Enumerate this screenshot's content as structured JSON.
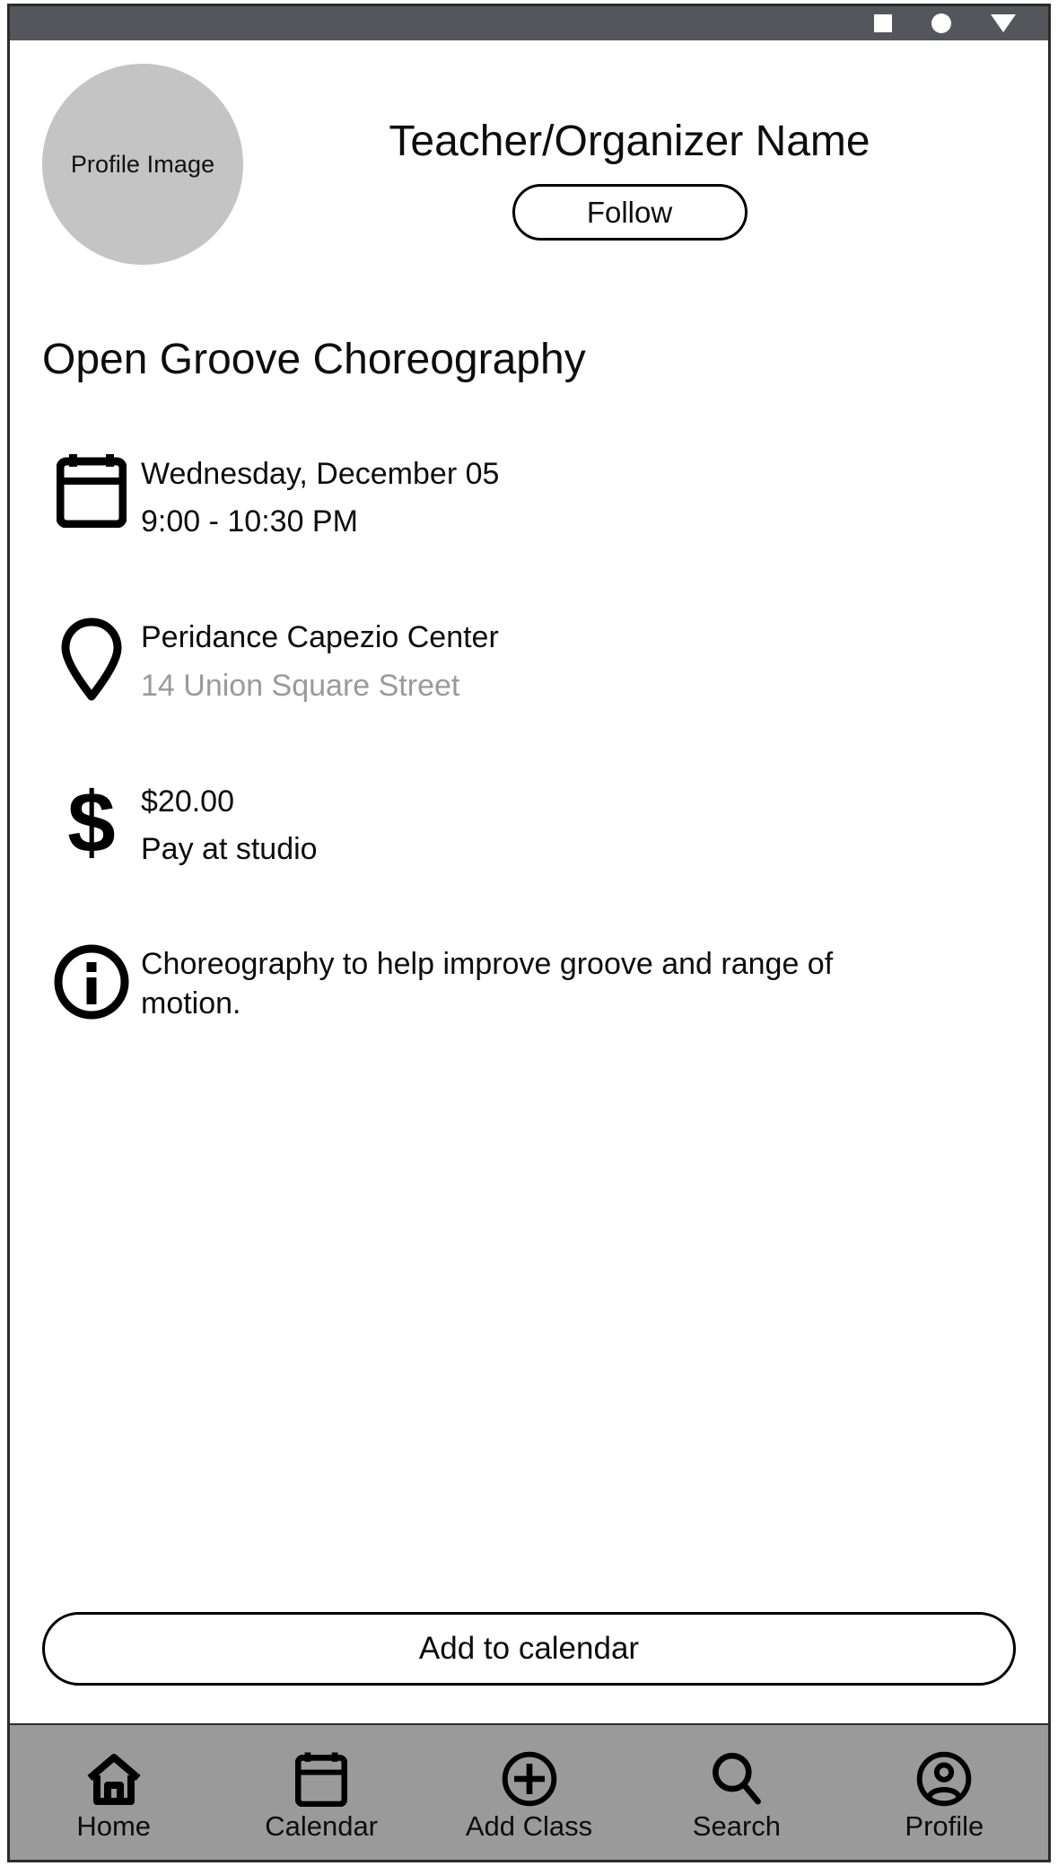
{
  "status_bar": {
    "background": "#55565b",
    "icons": [
      "square-icon",
      "circle-icon",
      "triangle-down-icon"
    ]
  },
  "profile": {
    "avatar_label": "Profile Image",
    "organizer_name": "Teacher/Organizer Name",
    "follow_label": "Follow"
  },
  "event": {
    "title": "Open Groove Choreography",
    "rows": [
      {
        "icon": "calendar-icon",
        "primary": "Wednesday, December 05",
        "secondary": "9:00 - 10:30 PM",
        "secondary_muted": false
      },
      {
        "icon": "location-pin-icon",
        "primary": "Peridance Capezio Center",
        "secondary": "14 Union Square Street",
        "secondary_muted": true
      },
      {
        "icon": "dollar-sign-icon",
        "primary": "$20.00",
        "secondary": "Pay at studio",
        "secondary_muted": false
      },
      {
        "icon": "info-circle-icon",
        "paragraph": "Choreography to help improve groove and range of motion."
      }
    ],
    "add_to_calendar_label": "Add to calendar"
  },
  "bottom_nav": {
    "background": "#9a9a9a",
    "items": [
      {
        "icon": "home-icon",
        "label": "Home"
      },
      {
        "icon": "calendar-icon",
        "label": "Calendar"
      },
      {
        "icon": "plus-circle-icon",
        "label": "Add Class"
      },
      {
        "icon": "search-icon",
        "label": "Search"
      },
      {
        "icon": "account-circle-icon",
        "label": "Profile"
      }
    ]
  },
  "colors": {
    "status_bar": "#55565b",
    "nav_bar": "#9a9a9a",
    "avatar": "#c4c4c4",
    "muted_text": "#9a9a9a",
    "text": "#0d0d0d"
  }
}
